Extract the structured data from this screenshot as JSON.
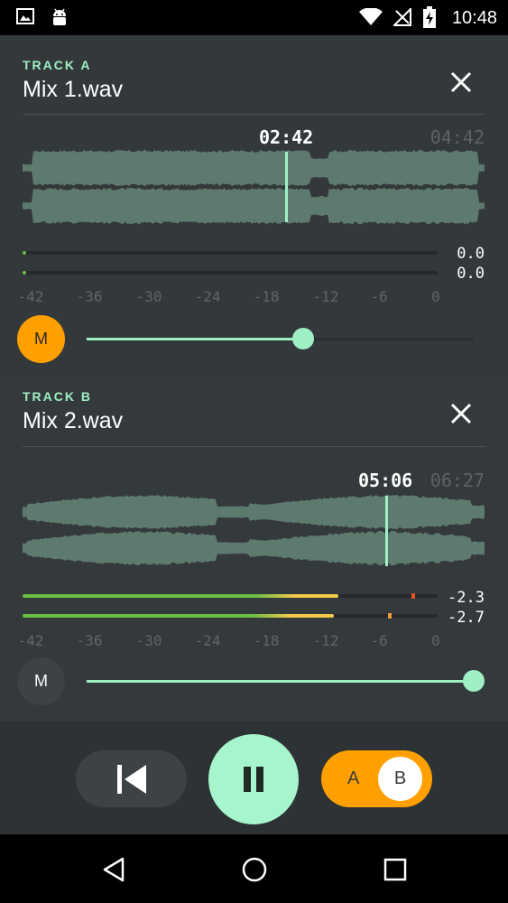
{
  "status_bar": {
    "time": "10:48",
    "icons": [
      "image-icon",
      "android-icon",
      "wifi-icon",
      "no-signal-icon",
      "battery-charging-icon"
    ]
  },
  "track_a": {
    "label": "TRACK A",
    "filename": "Mix 1.wav",
    "position": "02:42",
    "duration": "04:42",
    "meters": [
      {
        "value": "0.0",
        "level": 0.0
      },
      {
        "value": "0.0",
        "level": 0.0
      }
    ],
    "scale": [
      "-42",
      "-36",
      "-30",
      "-24",
      "-18",
      "-12",
      "-6",
      "0"
    ],
    "mute_label": "M",
    "mute_active": true,
    "volume": 0.56
  },
  "track_b": {
    "label": "TRACK B",
    "filename": "Mix 2.wav",
    "position": "05:06",
    "duration": "06:27",
    "meters": [
      {
        "value": "-2.3",
        "level": 0.76
      },
      {
        "value": "-2.7",
        "level": 0.75
      }
    ],
    "scale": [
      "-42",
      "-36",
      "-30",
      "-24",
      "-18",
      "-12",
      "-6",
      "0"
    ],
    "mute_label": "M",
    "mute_active": false,
    "volume": 1.0
  },
  "controls": {
    "ab_a": "A",
    "ab_b": "B",
    "selected": "B"
  },
  "colors": {
    "accent": "#9ef0c4",
    "mute_active": "#ffa000",
    "meter_green": "#6abf45",
    "meter_yellow": "#f3c84a",
    "peak_red": "#e0522a",
    "peak_orange": "#f39a3b"
  },
  "nav": {
    "icons": [
      "back-icon",
      "home-icon",
      "recents-icon"
    ]
  }
}
